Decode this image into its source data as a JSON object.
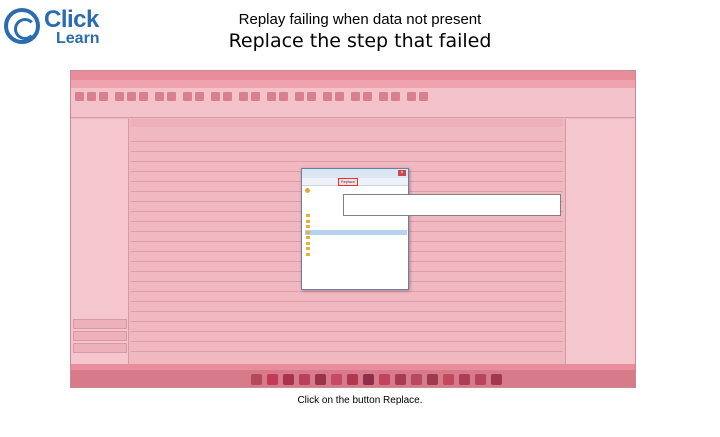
{
  "slide": {
    "logo_word1": "Click",
    "logo_word2": "Learn",
    "title_line1": "Replay failing when data not present",
    "title_line2": "Replace the step that failed",
    "caption": "Click on the button Replace."
  },
  "dialog": {
    "replace_label": "Replace"
  },
  "colors": {
    "overlay": "#f0b8c1",
    "brand_blue": "#2b6cb0",
    "highlight_red": "#ff2a2a"
  }
}
